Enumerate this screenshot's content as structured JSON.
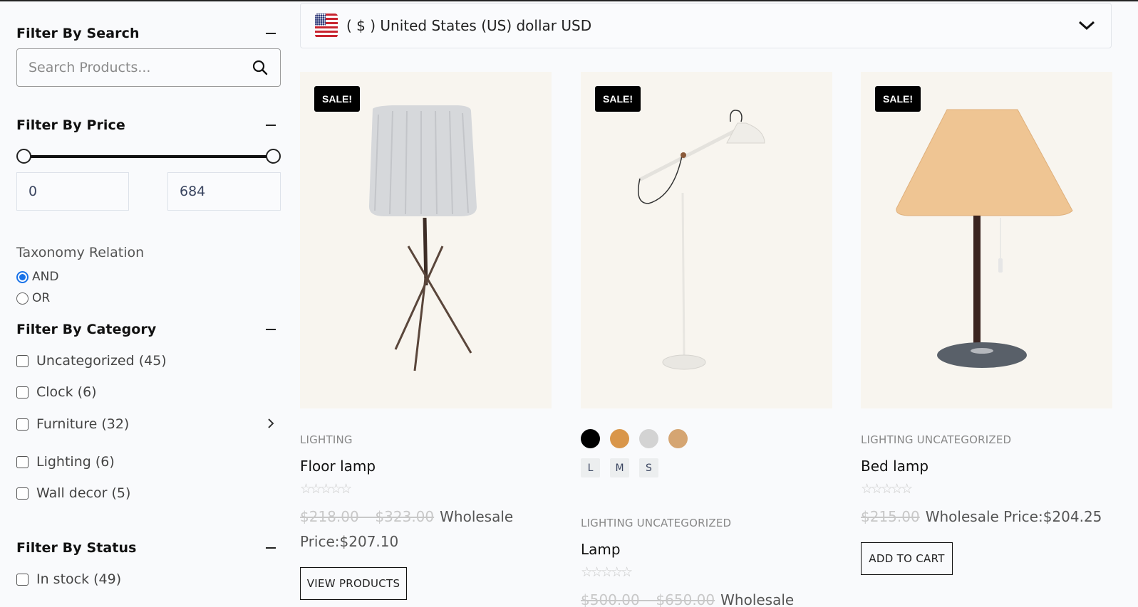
{
  "sidebar": {
    "search": {
      "title": "Filter By Search",
      "placeholder": "Search Products...",
      "value": ""
    },
    "price": {
      "title": "Filter By Price",
      "min": "0",
      "max": "684",
      "range_min": 0,
      "range_max": 684,
      "selected_min_fraction": 0,
      "selected_max_fraction": 1
    },
    "taxonomy": {
      "label": "Taxonomy Relation",
      "options": [
        {
          "label": "AND",
          "checked": true
        },
        {
          "label": "OR",
          "checked": false
        }
      ]
    },
    "category": {
      "title": "Filter By Category",
      "items": [
        {
          "label": "Uncategorized (45)",
          "checked": false
        },
        {
          "label": "Clock (6)",
          "checked": false
        },
        {
          "label": "Furniture (32)",
          "checked": false,
          "has_children": true
        },
        {
          "label": "Lighting (6)",
          "checked": false
        },
        {
          "label": "Wall decor (5)",
          "checked": false
        }
      ]
    },
    "status": {
      "title": "Filter By Status",
      "items": [
        {
          "label": "In stock (49)",
          "checked": false
        }
      ]
    }
  },
  "currency": {
    "label": "( $ ) United States (US) dollar USD",
    "flag": "us-flag-icon"
  },
  "products": [
    {
      "badge": "SALE!",
      "categories": "LIGHTING",
      "title": "Floor lamp",
      "rating": 0,
      "rating_max": 5,
      "old_price": "$218.00 – $323.00",
      "wholesale": "Wholesale Price:$207.10",
      "wholesale_part1": "Wholesale",
      "wholesale_part2": "Price:$207.10",
      "button": "VIEW PRODUCTS"
    },
    {
      "badge": "SALE!",
      "swatches": [
        "#000000",
        "#d9964a",
        "#d3d3d3",
        "#d5a572"
      ],
      "sizes": [
        "L",
        "M",
        "S"
      ],
      "categories": "LIGHTING  UNCATEGORIZED",
      "title": "Lamp",
      "rating": 0,
      "rating_max": 5,
      "old_price": "$500.00 – $650.00",
      "wholesale": "Wholesale"
    },
    {
      "badge": "SALE!",
      "categories": "LIGHTING  UNCATEGORIZED",
      "title": "Bed lamp",
      "rating": 0,
      "rating_max": 5,
      "old_price": "$215.00",
      "wholesale": "Wholesale Price:$204.25",
      "button": "ADD TO CART"
    }
  ],
  "colors": {
    "accent": "#1a73e8",
    "sale_badge": "#000000",
    "image_bg": "#f8f5ef"
  }
}
